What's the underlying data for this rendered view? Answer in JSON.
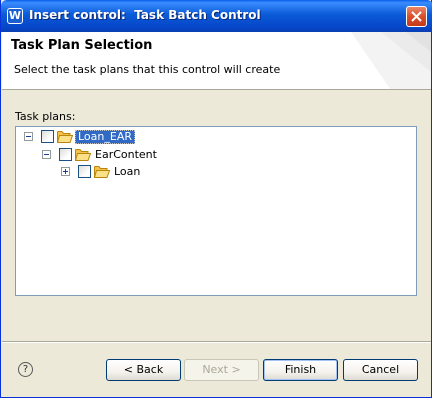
{
  "window": {
    "title": "Insert control:  Task Batch Control"
  },
  "banner": {
    "title": "Task Plan Selection",
    "subtitle": "Select the task plans that this control will create"
  },
  "tree": {
    "label": "Task plans:",
    "nodes": [
      {
        "label": "Loan_EAR",
        "level": 0,
        "expanded": true,
        "checked": false,
        "selected": true
      },
      {
        "label": "EarContent",
        "level": 1,
        "expanded": true,
        "checked": false,
        "selected": false
      },
      {
        "label": "Loan",
        "level": 2,
        "expanded": false,
        "checked": false,
        "selected": false
      }
    ]
  },
  "footer": {
    "help_icon": "?",
    "back_label": "< Back",
    "next_label": "Next >",
    "finish_label": "Finish",
    "cancel_label": "Cancel"
  },
  "colors": {
    "titlebar": "#0b5bd7",
    "selection": "#316ac5",
    "folder": "#f4c24b",
    "close": "#d9502c"
  },
  "icons": {
    "app": "app-logo-icon",
    "close": "close-icon",
    "folder": "folder-open-icon",
    "help": "help-icon"
  }
}
